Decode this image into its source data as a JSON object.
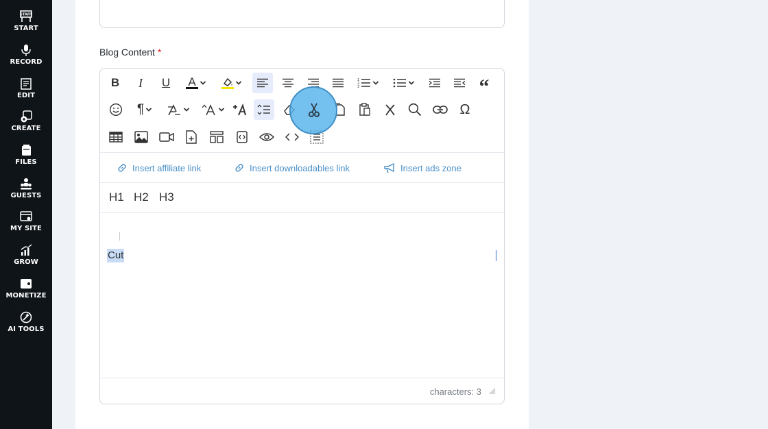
{
  "sidebar": {
    "items": [
      {
        "label": "START",
        "icon": "start-icon"
      },
      {
        "label": "RECORD",
        "icon": "microphone-icon"
      },
      {
        "label": "EDIT",
        "icon": "edit-icon"
      },
      {
        "label": "CREATE",
        "icon": "create-icon"
      },
      {
        "label": "FILES",
        "icon": "files-icon"
      },
      {
        "label": "GUESTS",
        "icon": "guests-icon"
      },
      {
        "label": "MY SITE",
        "icon": "my-site-icon"
      },
      {
        "label": "GROW",
        "icon": "grow-icon"
      },
      {
        "label": "MONETIZE",
        "icon": "monetize-icon"
      },
      {
        "label": "AI TOOLS",
        "icon": "ai-tools-icon"
      }
    ]
  },
  "form": {
    "blog_content_label": "Blog Content",
    "required_mark": "*"
  },
  "toolbar": {
    "bold": "B",
    "italic": "I",
    "underline": "U",
    "font_color_letter": "A",
    "font_color_swatch": "#111111",
    "highlight_swatch": "#f5e400",
    "accent_active_bg": "#e6ecfb",
    "quote": "“",
    "pilcrow": "¶",
    "omega": "Ω",
    "active_tool": "cut"
  },
  "insert_links": {
    "affiliate": "Insert affiliate link",
    "downloadables": "Insert downloadables link",
    "ads_zone": "Insert ads zone"
  },
  "headings": [
    "H1",
    "H2",
    "H3"
  ],
  "content": {
    "selected_text": "Cut"
  },
  "status": {
    "characters": "characters: 3"
  },
  "colors": {
    "sidebar_bg": "#0f1419",
    "link": "#4a90c8",
    "click_highlight": "#56b2ec",
    "selection": "#c9dcf6"
  }
}
